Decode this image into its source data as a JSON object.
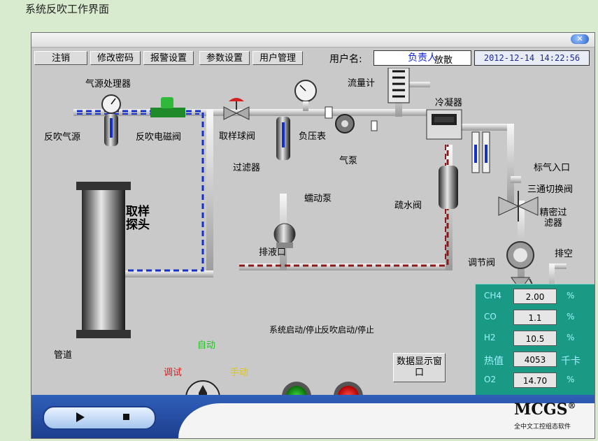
{
  "caption": "系统反吹工作界面",
  "toolbar": {
    "buttons": [
      "注销",
      "修改密码",
      "报警设置",
      "参数设置",
      "用户管理"
    ],
    "user_label": "用户名:",
    "user_value": "负责人",
    "datetime": "2012-12-14 14:22:56"
  },
  "labels": {
    "air_processor": "气源处理器",
    "backflush_source": "反吹气源",
    "backflush_valve": "反吹电磁阀",
    "sampling_ball_valve": "取样球阀",
    "neg_pressure_gauge": "负压表",
    "flowmeter": "流量计",
    "vent": "放散",
    "condenser": "冷凝器",
    "air_pump": "气泵",
    "filter": "过滤器",
    "peristaltic_pump": "蠕动泵",
    "drain_valve": "疏水阀",
    "std_gas_inlet": "标气入口",
    "three_way_valve": "三通切换阀",
    "precision_filter": "精密过滤器",
    "regulating_valve": "调节阀",
    "exhaust": "排空",
    "sampling_probe": "取样探头",
    "drain_port": "排液口",
    "pipe": "管道",
    "mode_auto": "自动",
    "mode_debug": "调试",
    "mode_manual": "手动",
    "system_start_stop": "系统启动/停止",
    "backflush_start_stop": "反吹启动/停止",
    "data_window": "数据显示窗口"
  },
  "readings": [
    {
      "name": "CH4",
      "value": "2.00",
      "unit": "%"
    },
    {
      "name": "CO",
      "value": "1.1",
      "unit": "%"
    },
    {
      "name": "H2",
      "value": "10.5",
      "unit": "%"
    },
    {
      "name": "热值",
      "value": "4053",
      "unit": "千卡"
    },
    {
      "name": "O2",
      "value": "14.70",
      "unit": "%"
    }
  ],
  "brand": {
    "name": "MCGS",
    "subtitle": "全中文工控组态软件",
    "reg": "®"
  },
  "colors": {
    "panel": "#1a9a84",
    "pipe_blue": "#1530c8",
    "pipe_red": "#8a1a1a",
    "btn_green": "#1fa31f",
    "btn_red": "#ee1515"
  }
}
